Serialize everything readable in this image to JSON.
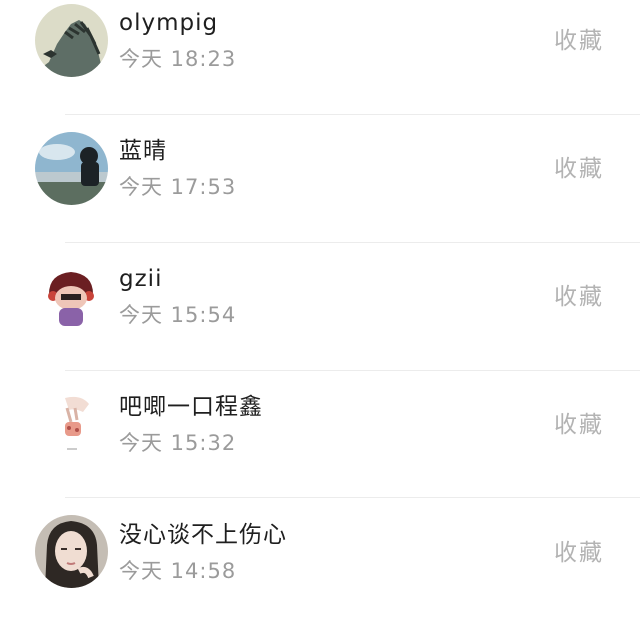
{
  "items": [
    {
      "name": "olympig",
      "time": "今天 18:23",
      "action": "收藏",
      "avatar_icon": "zebra-avatar"
    },
    {
      "name": "蓝晴",
      "time": "今天 17:53",
      "action": "收藏",
      "avatar_icon": "lake-sky-avatar"
    },
    {
      "name": "gzii",
      "time": "今天 15:54",
      "action": "收藏",
      "avatar_icon": "cartoon-character-avatar"
    },
    {
      "name": "吧唧一口程鑫",
      "time": "今天 15:32",
      "action": "收藏",
      "avatar_icon": "hand-holding-treat-avatar"
    },
    {
      "name": "没心谈不上伤心",
      "time": "今天 14:58",
      "action": "收藏",
      "avatar_icon": "girl-portrait-avatar"
    }
  ],
  "colors": {
    "name": "#1f1f1f",
    "time": "#9b9b9b",
    "action": "#b3b3b3",
    "divider": "#ececec"
  }
}
